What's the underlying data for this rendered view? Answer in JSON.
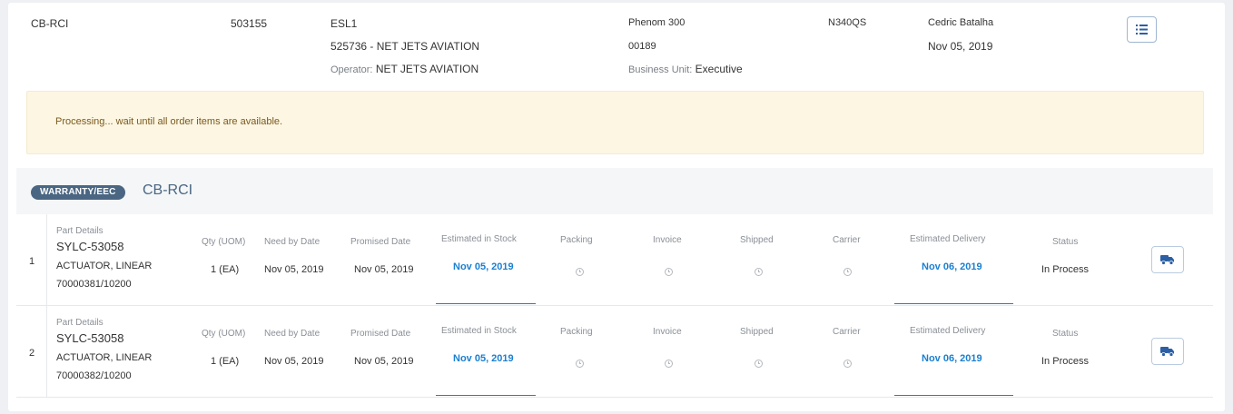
{
  "order": {
    "code": "CB-RCI",
    "number": "503155",
    "customer_code": "ESL1",
    "customer_name": "525736 - NET JETS AVIATION",
    "operator_label": "Operator:",
    "operator_value": "NET JETS AVIATION",
    "aircraft_model": "Phenom 300",
    "serial": "00189",
    "business_unit_label": "Business Unit:",
    "business_unit_value": "Executive",
    "registration": "N340QS",
    "requester": "Cedric Batalha",
    "date": "Nov 05, 2019",
    "menu_icon": "list-icon"
  },
  "alert": {
    "message": "Processing... wait until all order items are available."
  },
  "section": {
    "badge": "WARRANTY/EEC",
    "title": "CB-RCI"
  },
  "columns": {
    "part_details": "Part Details",
    "qty": "Qty (UOM)",
    "need_by": "Need by Date",
    "promised": "Promised Date",
    "est_stock": "Estimated in Stock",
    "packing": "Packing",
    "invoice": "Invoice",
    "shipped": "Shipped",
    "carrier": "Carrier",
    "est_delivery": "Estimated Delivery",
    "status": "Status"
  },
  "items": [
    {
      "index": "1",
      "part_number": "SYLC-53058",
      "description": "ACTUATOR, LINEAR",
      "reference": "70000381/10200",
      "qty": "1 (EA)",
      "need_by": "Nov 05, 2019",
      "promised": "Nov 05, 2019",
      "est_stock": "Nov 05, 2019",
      "est_delivery": "Nov 06, 2019",
      "status": "In Process",
      "action_icon": "truck-icon"
    },
    {
      "index": "2",
      "part_number": "SYLC-53058",
      "description": "ACTUATOR, LINEAR",
      "reference": "70000382/10200",
      "qty": "1 (EA)",
      "need_by": "Nov 05, 2019",
      "promised": "Nov 05, 2019",
      "est_stock": "Nov 05, 2019",
      "est_delivery": "Nov 06, 2019",
      "status": "In Process",
      "action_icon": "truck-icon"
    }
  ],
  "colors": {
    "accent_blue": "#1a7fd1",
    "badge": "#4a6682",
    "alert_bg": "#fcf6e3",
    "alert_text": "#7b5a1e"
  }
}
